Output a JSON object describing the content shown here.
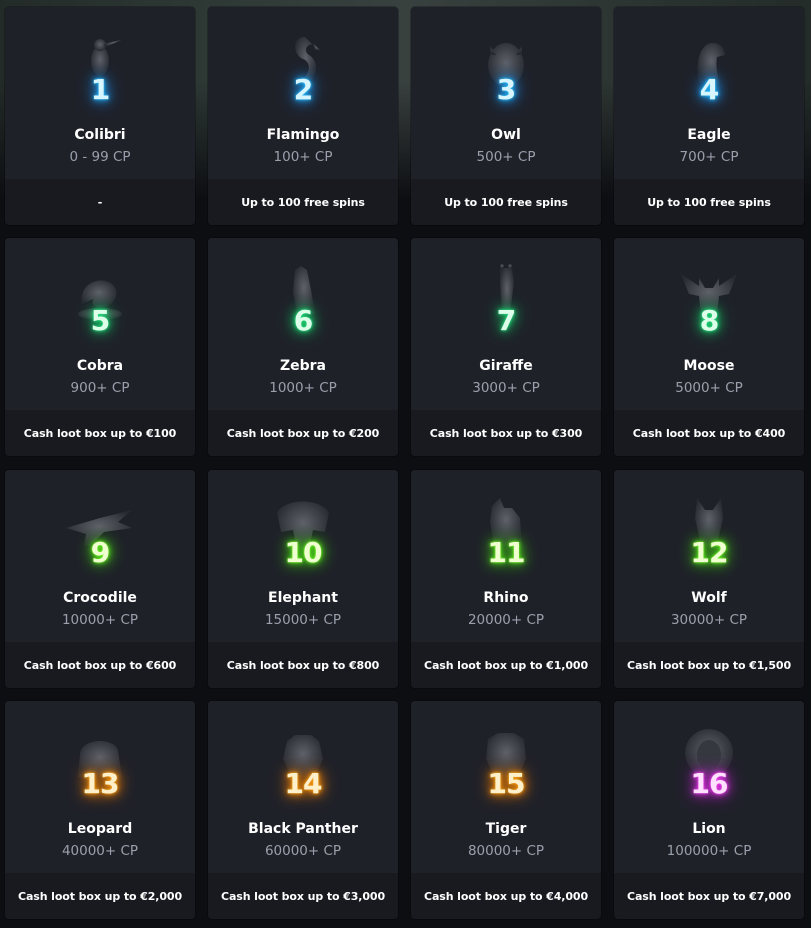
{
  "levels": [
    {
      "number": "1",
      "name": "Colibri",
      "cp": "0 - 99 CP",
      "reward": "-",
      "color": "blue",
      "icon": "hummingbird-icon"
    },
    {
      "number": "2",
      "name": "Flamingo",
      "cp": "100+ CP",
      "reward": "Up to 100 free spins",
      "color": "blue",
      "icon": "flamingo-icon"
    },
    {
      "number": "3",
      "name": "Owl",
      "cp": "500+ CP",
      "reward": "Up to 100 free spins",
      "color": "blue",
      "icon": "owl-icon"
    },
    {
      "number": "4",
      "name": "Eagle",
      "cp": "700+ CP",
      "reward": "Up to 100 free spins",
      "color": "blue",
      "icon": "eagle-icon"
    },
    {
      "number": "5",
      "name": "Cobra",
      "cp": "900+ CP",
      "reward": "Cash loot box up to €100",
      "color": "green",
      "icon": "cobra-icon"
    },
    {
      "number": "6",
      "name": "Zebra",
      "cp": "1000+ CP",
      "reward": "Cash loot box up to €200",
      "color": "green",
      "icon": "zebra-icon"
    },
    {
      "number": "7",
      "name": "Giraffe",
      "cp": "3000+ CP",
      "reward": "Cash loot box up to €300",
      "color": "green",
      "icon": "giraffe-icon"
    },
    {
      "number": "8",
      "name": "Moose",
      "cp": "5000+ CP",
      "reward": "Cash loot box up to €400",
      "color": "green",
      "icon": "moose-icon"
    },
    {
      "number": "9",
      "name": "Crocodile",
      "cp": "10000+ CP",
      "reward": "Cash loot box up to €600",
      "color": "lime",
      "icon": "crocodile-icon"
    },
    {
      "number": "10",
      "name": "Elephant",
      "cp": "15000+ CP",
      "reward": "Cash loot box up to €800",
      "color": "lime",
      "icon": "elephant-icon"
    },
    {
      "number": "11",
      "name": "Rhino",
      "cp": "20000+ CP",
      "reward": "Cash loot box up to €1,000",
      "color": "lime",
      "icon": "rhino-icon"
    },
    {
      "number": "12",
      "name": "Wolf",
      "cp": "30000+ CP",
      "reward": "Cash loot box up to €1,500",
      "color": "lime",
      "icon": "wolf-icon"
    },
    {
      "number": "13",
      "name": "Leopard",
      "cp": "40000+ CP",
      "reward": "Cash loot box up to €2,000",
      "color": "orange",
      "icon": "leopard-icon"
    },
    {
      "number": "14",
      "name": "Black Panther",
      "cp": "60000+ CP",
      "reward": "Cash loot box up to €3,000",
      "color": "orange",
      "icon": "panther-icon"
    },
    {
      "number": "15",
      "name": "Tiger",
      "cp": "80000+ CP",
      "reward": "Cash loot box up to €4,000",
      "color": "orange",
      "icon": "tiger-icon"
    },
    {
      "number": "16",
      "name": "Lion",
      "cp": "100000+ CP",
      "reward": "Cash loot box up to €7,000",
      "color": "pink",
      "icon": "lion-icon"
    }
  ],
  "colors": {
    "card_background": "#1f2129",
    "reward_background": "#181a20",
    "page_background": "#0d0e12",
    "blue_glow": "#1fb6ff",
    "green_glow": "#20d977",
    "lime_glow": "#5ef01f",
    "orange_glow": "#ff9a10",
    "pink_glow": "#f03cf0"
  }
}
